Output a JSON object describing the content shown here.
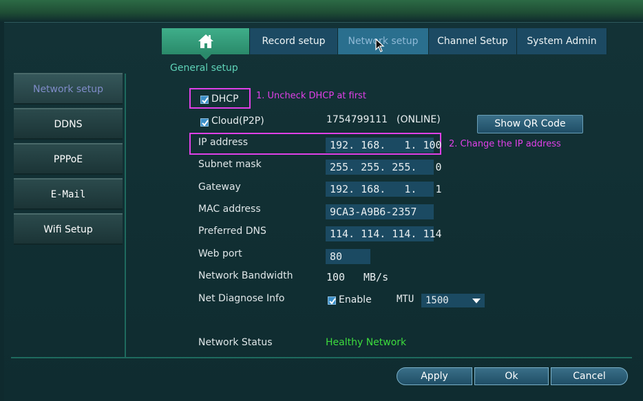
{
  "tabs": {
    "home_icon": "home-icon",
    "record_setup": "Record setup",
    "network_setup": "Network setup",
    "channel_setup": "Channel Setup",
    "system_admin": "System Admin"
  },
  "section_title": "General setup",
  "side_menu": [
    {
      "label": "Network setup",
      "active": true
    },
    {
      "label": "DDNS"
    },
    {
      "label": "PPPoE"
    },
    {
      "label": "E-Mail"
    },
    {
      "label": "Wifi Setup"
    }
  ],
  "form": {
    "dhcp": {
      "label": "DHCP",
      "checked": true
    },
    "cloud": {
      "label": "Cloud(P2P)",
      "checked": true,
      "id": "1754799111",
      "status": "(ONLINE)"
    },
    "show_qr_button": "Show QR Code",
    "ip_address": {
      "label": "IP address",
      "value": "192. 168.   1. 100"
    },
    "subnet_mask": {
      "label": "Subnet mask",
      "value": "255. 255. 255.   0"
    },
    "gateway": {
      "label": "Gateway",
      "value": "192. 168.   1.   1"
    },
    "mac_address": {
      "label": "MAC address",
      "value": "9CA3-A9B6-2357"
    },
    "preferred_dns": {
      "label": "Preferred DNS",
      "value": "114. 114. 114. 114"
    },
    "web_port": {
      "label": "Web port",
      "value": "80"
    },
    "network_bandwidth": {
      "label": "Network Bandwidth",
      "value": "100",
      "unit": "MB/s"
    },
    "net_diagnose": {
      "label": "Net Diagnose Info",
      "enable_label": "Enable",
      "enabled": true,
      "mtu_label": "MTU",
      "mtu_value": "1500"
    },
    "network_status": {
      "label": "Network Status",
      "value": "Healthy Network"
    }
  },
  "annotations": {
    "step1": "1. Uncheck DHCP at first",
    "step2": "2. Change the IP address"
  },
  "buttons": {
    "apply": "Apply",
    "ok": "Ok",
    "cancel": "Cancel"
  },
  "colors": {
    "annotation": "#e040e8",
    "status_ok": "#3ddc3d",
    "accent": "#5ed3b8"
  }
}
